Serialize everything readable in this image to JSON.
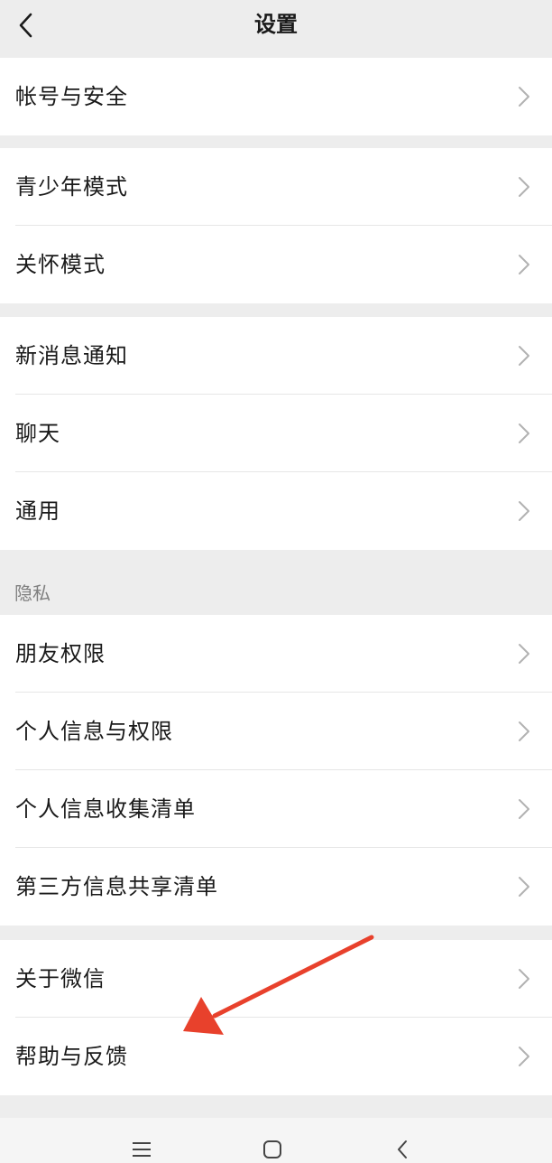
{
  "header": {
    "title": "设置"
  },
  "groups": [
    {
      "items": [
        "帐号与安全"
      ]
    },
    {
      "items": [
        "青少年模式",
        "关怀模式"
      ]
    },
    {
      "items": [
        "新消息通知",
        "聊天",
        "通用"
      ]
    },
    {
      "header": "隐私",
      "items": [
        "朋友权限",
        "个人信息与权限",
        "个人信息收集清单",
        "第三方信息共享清单"
      ]
    },
    {
      "items": [
        "关于微信",
        "帮助与反馈"
      ]
    }
  ],
  "icons": {
    "back": "back-chevron-icon",
    "row": "chevron-right-icon",
    "nav_menu": "menu-icon",
    "nav_home": "home-square-icon",
    "nav_back": "back-icon"
  },
  "colors": {
    "background": "#ededed",
    "card": "#ffffff",
    "annotation_arrow": "#e8412c"
  }
}
